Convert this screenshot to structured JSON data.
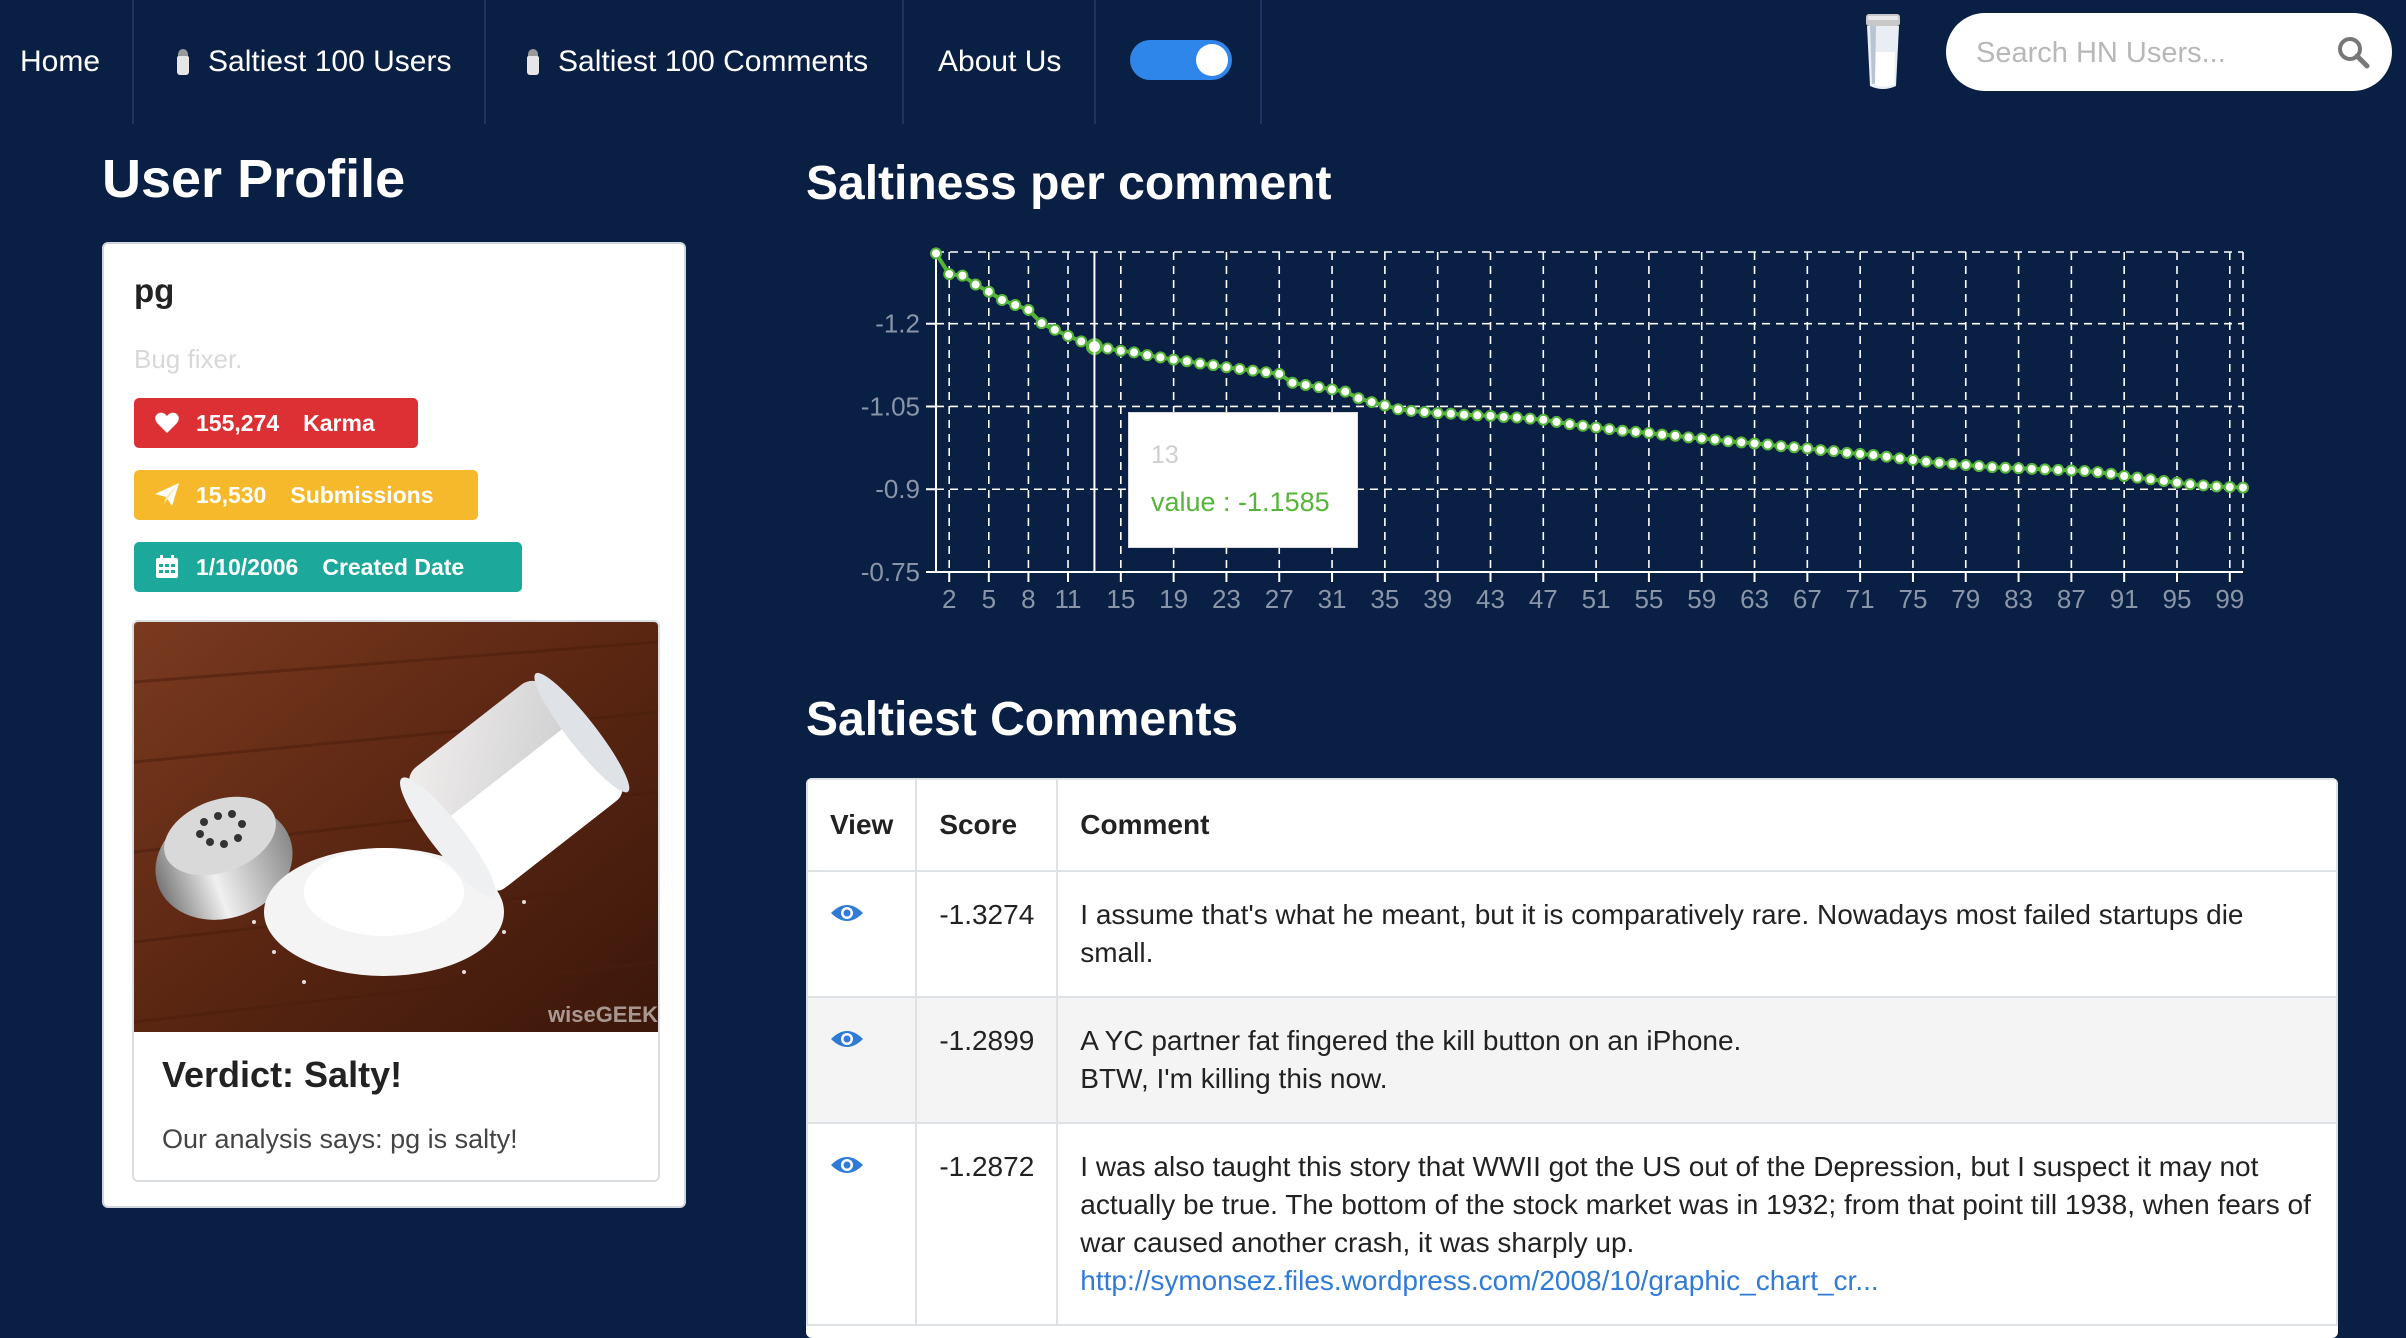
{
  "nav": {
    "home": "Home",
    "users": "Saltiest 100 Users",
    "comments": "Saltiest 100 Comments",
    "about": "About Us",
    "search_placeholder": "Search HN Users..."
  },
  "profile": {
    "section_title": "User Profile",
    "username": "pg",
    "about": "Bug fixer.",
    "karma_value": "155,274",
    "karma_label": "Karma",
    "submissions_value": "15,530",
    "submissions_label": "Submissions",
    "created_value": "1/10/2006",
    "created_label": "Created Date",
    "image_watermark": "wiseGEEK",
    "verdict": "Verdict: Salty!",
    "analysis": "Our analysis says: pg is salty!"
  },
  "chart": {
    "section_title": "Saltiness per comment",
    "tooltip_label": "13",
    "tooltip_value": "value : -1.1585"
  },
  "chart_data": {
    "type": "line",
    "title": "Saltiness per comment",
    "xlabel": "",
    "ylabel": "",
    "x_ticks": [
      2,
      5,
      8,
      11,
      15,
      19,
      23,
      27,
      31,
      35,
      39,
      43,
      47,
      51,
      55,
      59,
      63,
      67,
      71,
      75,
      79,
      83,
      87,
      91,
      95,
      99
    ],
    "y_ticks": [
      "-1.2",
      "-1.05",
      "-0.9",
      "-0.75"
    ],
    "ylim": [
      -1.33,
      -0.75
    ],
    "y_reversed": true,
    "grid": true,
    "x": [
      1,
      2,
      3,
      4,
      5,
      6,
      7,
      8,
      9,
      10,
      11,
      12,
      13,
      14,
      15,
      16,
      17,
      18,
      19,
      20,
      21,
      22,
      23,
      24,
      25,
      26,
      27,
      28,
      29,
      30,
      31,
      32,
      33,
      34,
      35,
      36,
      37,
      38,
      39,
      40,
      41,
      42,
      43,
      44,
      45,
      46,
      47,
      48,
      49,
      50,
      51,
      52,
      53,
      54,
      55,
      56,
      57,
      58,
      59,
      60,
      61,
      62,
      63,
      64,
      65,
      66,
      67,
      68,
      69,
      70,
      71,
      72,
      73,
      74,
      75,
      76,
      77,
      78,
      79,
      80,
      81,
      82,
      83,
      84,
      85,
      86,
      87,
      88,
      89,
      90,
      91,
      92,
      93,
      94,
      95,
      96,
      97,
      98,
      99,
      100
    ],
    "series": [
      {
        "values": [
          -1.3274,
          -1.2899,
          -1.2872,
          -1.271,
          -1.258,
          -1.243,
          -1.234,
          -1.225,
          -1.201,
          -1.189,
          -1.178,
          -1.168,
          -1.1585,
          -1.155,
          -1.151,
          -1.148,
          -1.143,
          -1.139,
          -1.135,
          -1.132,
          -1.128,
          -1.125,
          -1.121,
          -1.118,
          -1.115,
          -1.112,
          -1.109,
          -1.093,
          -1.089,
          -1.085,
          -1.081,
          -1.077,
          -1.065,
          -1.058,
          -1.052,
          -1.045,
          -1.042,
          -1.04,
          -1.038,
          -1.037,
          -1.035,
          -1.034,
          -1.033,
          -1.031,
          -1.03,
          -1.028,
          -1.026,
          -1.022,
          -1.018,
          -1.015,
          -1.012,
          -1.009,
          -1.006,
          -1.004,
          -1.002,
          -0.999,
          -0.997,
          -0.994,
          -0.992,
          -0.99,
          -0.987,
          -0.985,
          -0.983,
          -0.981,
          -0.978,
          -0.976,
          -0.974,
          -0.971,
          -0.969,
          -0.966,
          -0.964,
          -0.962,
          -0.959,
          -0.956,
          -0.953,
          -0.95,
          -0.948,
          -0.946,
          -0.944,
          -0.942,
          -0.94,
          -0.939,
          -0.938,
          -0.937,
          -0.936,
          -0.935,
          -0.934,
          -0.933,
          -0.931,
          -0.928,
          -0.924,
          -0.921,
          -0.918,
          -0.915,
          -0.912,
          -0.909,
          -0.907,
          -0.905,
          -0.904,
          -0.903
        ]
      }
    ],
    "line_color": "#55b53a"
  },
  "comments": {
    "section_title": "Saltiest Comments",
    "headers": [
      "View",
      "Score",
      "Comment"
    ],
    "rows": [
      {
        "score": "-1.3274",
        "text": "I assume that's what he meant, but it is comparatively rare. Nowadays most failed startups die small."
      },
      {
        "score": "-1.2899",
        "line1": "A YC partner fat fingered the kill button on an iPhone.",
        "line2": "BTW, I'm killing this now."
      },
      {
        "score": "-1.2872",
        "text": "I was also taught this story that WWII got the US out of the Depression, but I suspect it may not actually be true. The bottom of the stock market was in 1932; from that point till 1938, when fears of war caused another crash, it was sharply up.",
        "link": "http://symonsez.files.wordpress.com/2008/10/graphic_chart_cr..."
      }
    ]
  },
  "colors": {
    "background": "#0a1f44",
    "karma": "#dc3035",
    "submissions": "#f5b92b",
    "created": "#1ca89a",
    "toggle": "#2f86ea",
    "link": "#2f7bd6"
  }
}
